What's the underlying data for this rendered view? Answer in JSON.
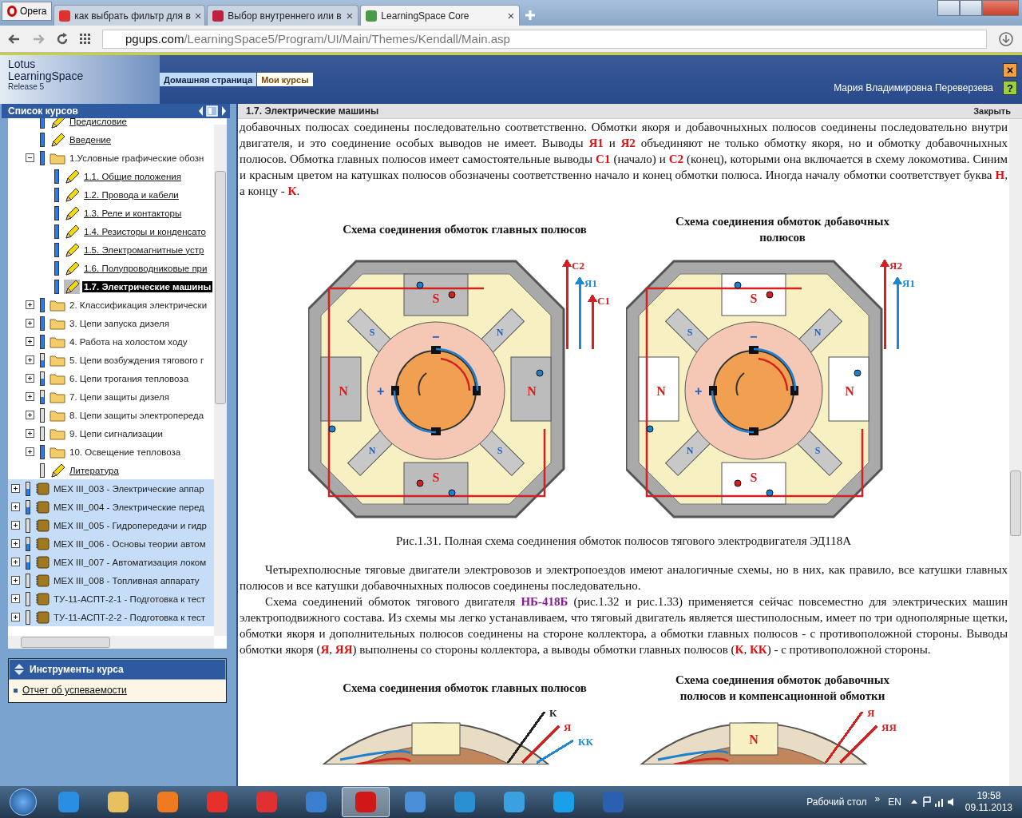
{
  "browser": {
    "menu": "Opera",
    "tabs": [
      {
        "title": "как выбрать фильтр для в",
        "kind": "yandex",
        "close": "×",
        "selected": false
      },
      {
        "title": "Выбор внутреннего или в",
        "kind": "bug",
        "close": "×",
        "selected": false
      },
      {
        "title": "LearningSpace Core",
        "kind": "ls",
        "close": "×",
        "selected": true
      }
    ],
    "address": {
      "domain": "pgups.com",
      "path": "/LearningSpace5/Program/UI/Main/Themes/Kendall/Main.asp"
    }
  },
  "header": {
    "logo": [
      "Lotus",
      "LearningSpace",
      "Release 5"
    ],
    "tabs": [
      {
        "label": "Домашняя страница",
        "selected": false
      },
      {
        "label": "Мои курсы",
        "selected": true
      }
    ],
    "user": "Мария Владимировна Переверзева",
    "close": "×",
    "help": "?"
  },
  "sidebar": {
    "title": "Список курсов",
    "items": [
      {
        "label": "Предисловие",
        "kind": "lesson",
        "level": 1,
        "selected": false
      },
      {
        "label": "Введение",
        "kind": "lesson",
        "level": 1,
        "selected": false
      },
      {
        "label": "1.Условные графические обозн",
        "kind": "folder",
        "level": 1,
        "expanded": true,
        "selected": false,
        "children": [
          {
            "label": "1.1. Общие положения",
            "kind": "lesson",
            "level": 1,
            "selected": false
          },
          {
            "label": "1.2. Провода и кабели",
            "kind": "lesson",
            "level": 1,
            "selected": false
          },
          {
            "label": "1.3. Реле и контакторы",
            "kind": "lesson",
            "level": 1,
            "selected": false
          },
          {
            "label": "1.4. Резисторы и конденсато",
            "kind": "lesson",
            "level": 1,
            "selected": false
          },
          {
            "label": "1.5. Электромагнитные устр",
            "kind": "lesson",
            "level": 1,
            "selected": false
          },
          {
            "label": "1.6. Полупроводниковые при",
            "kind": "lesson",
            "level": 1,
            "selected": false
          },
          {
            "label": "1.7. Электрические машины",
            "kind": "lesson",
            "level": 1,
            "selected": true
          }
        ]
      },
      {
        "label": "2. Классификация электрически",
        "kind": "folder",
        "level": 1,
        "expanded": false,
        "selected": false
      },
      {
        "label": "3. Цепи запуска дизеля",
        "kind": "folder",
        "level": 1,
        "expanded": false,
        "selected": false
      },
      {
        "label": "4. Работа на холостом ходу",
        "kind": "folder",
        "level": 1,
        "expanded": false,
        "selected": false
      },
      {
        "label": "5. Цепи возбуждения тягового г",
        "kind": "folder",
        "level": 0.5,
        "expanded": false,
        "selected": false
      },
      {
        "label": "6. Цепи трогания тепловоза",
        "kind": "folder",
        "level": 0.5,
        "expanded": false,
        "selected": false
      },
      {
        "label": "7. Цепи защиты дизеля",
        "kind": "folder",
        "level": 0.5,
        "expanded": false,
        "selected": false
      },
      {
        "label": "8. Цепи защиты электропереда",
        "kind": "folder",
        "level": 0,
        "expanded": false,
        "selected": false
      },
      {
        "label": "9. Цепи сигнализации",
        "kind": "folder",
        "level": 0,
        "expanded": false,
        "selected": false
      },
      {
        "label": "10. Освещение тепловоза",
        "kind": "folder",
        "level": 1,
        "expanded": false,
        "selected": false
      },
      {
        "label": "Литература",
        "kind": "lesson",
        "level": 0,
        "selected": false
      }
    ],
    "courses": [
      {
        "label": "MEX III_003 - Электрические аппар",
        "level": 0.5,
        "expanded": false
      },
      {
        "label": "MEX III_004 - Электрические перед",
        "level": 0.5,
        "expanded": false
      },
      {
        "label": "MEX III_005 - Гидропередачи и гидр",
        "level": 0,
        "expanded": false
      },
      {
        "label": "MEX III_006 - Основы теории автом",
        "level": 0.5,
        "expanded": false
      },
      {
        "label": "MEX III_007 - Автоматизация локом",
        "level": 0.5,
        "expanded": false
      },
      {
        "label": "MEX III_008 - Топливная аппарату",
        "level": 0,
        "expanded": false
      },
      {
        "label": "ТУ-11-АСПТ-2-1 - Подготовка к тест",
        "level": 0,
        "expanded": false
      },
      {
        "label": "ТУ-11-АСПТ-2-2 - Подготовка к тест",
        "level": 0,
        "expanded": false
      }
    ],
    "tools": {
      "title": "Инструменты курса",
      "links": [
        "Отчет об успеваемости"
      ]
    }
  },
  "content": {
    "title": "1.7. Электрические машины",
    "close": "Закрыть",
    "blocks": [
      {
        "kind": "paragraph",
        "continued": true,
        "segments": [
          {
            "kind": "text",
            "text": "добавочных полюсах соединены последовательно соответственно. Обмотки якоря и добавочныхных полюсов соединены последовательно внутри двигателя, и это соединение особых выводов не имеет. Выводы "
          },
          {
            "kind": "red",
            "text": "Я1"
          },
          {
            "kind": "text",
            "text": " и "
          },
          {
            "kind": "red",
            "text": "Я2"
          },
          {
            "kind": "text",
            "text": " объединяют не только обмотку якоря, но и обмотку добавочныхных полюсов. Обмотка главных полюсов имеет самостоятельные выводы "
          },
          {
            "kind": "red",
            "text": "С1"
          },
          {
            "kind": "text",
            "text": " (начало) и "
          },
          {
            "kind": "red",
            "text": "С2"
          },
          {
            "kind": "text",
            "text": " (конец), которыми она включается в схему локомотива. Синим и красным цветом на катушках полюсов обозначены соответственно начало и конец обмотки полюса. Иногда началу обмотки соответствует буква "
          },
          {
            "kind": "red",
            "text": "Н"
          },
          {
            "kind": "text",
            "text": ", а концу - "
          },
          {
            "kind": "red",
            "text": "К"
          },
          {
            "kind": "text",
            "text": "."
          }
        ]
      },
      {
        "kind": "figure",
        "partial": false,
        "caption": "Рис.1.31. Полная схема соединения обмоток полюсов тягового электродвигателя ЭД118А",
        "diagrams": [
          {
            "title": "Схема соединения обмоток главных полюсов",
            "leads": [
              {
                "label": "С2",
                "color": "#d42020"
              },
              {
                "label": "Я1",
                "color": "#1e88d8"
              },
              {
                "label": "С1",
                "color": "#d42020"
              }
            ],
            "poles": [
              "S",
              "S",
              "N",
              "N",
              "S",
              "N",
              "N",
              "S"
            ],
            "plus": "+",
            "minus": "−"
          },
          {
            "title": "Схема соединения обмоток добавочных полюсов",
            "leads": [
              {
                "label": "Я2",
                "color": "#d42020"
              },
              {
                "label": "Я1",
                "color": "#1e88d8"
              }
            ],
            "poles": [
              "S",
              "S",
              "N",
              "N",
              "S",
              "N",
              "N",
              "S"
            ],
            "plus": "+",
            "minus": "−"
          }
        ]
      },
      {
        "kind": "paragraph",
        "continued": false,
        "segments": [
          {
            "kind": "text",
            "text": "Четырехполюсные тяговые двигатели электровозов и электропоездов имеют аналогичные схемы, но в них, как правило, все катушки главных полюсов и все катушки добавочныхных полюсов соединены последовательно."
          }
        ]
      },
      {
        "kind": "paragraph",
        "continued": false,
        "segments": [
          {
            "kind": "text",
            "text": "Схема соединений обмоток тягового двигателя "
          },
          {
            "kind": "purple",
            "text": "НБ-418Б"
          },
          {
            "kind": "text",
            "text": " (рис.1.32 и рис.1.33) применяется сейчас повсеместно для электрических машин электроподвижного состава. Из схемы мы легко устанавливаем, что тяговый двигатель является шестиполосным, имеет по три однополярные щетки, обмотки якоря и дополнительных полюсов соединены на стороне коллектора, а обмотки главных полюсов - с противоположной стороны. Выводы обмотки якоря ("
          },
          {
            "kind": "red",
            "text": "Я"
          },
          {
            "kind": "text",
            "text": ", "
          },
          {
            "kind": "red",
            "text": "ЯЯ"
          },
          {
            "kind": "text",
            "text": ") выполнены со стороны коллектора, а выводы обмотки главных полюсов ("
          },
          {
            "kind": "red",
            "text": "К"
          },
          {
            "kind": "text",
            "text": ", "
          },
          {
            "kind": "red",
            "text": "КК"
          },
          {
            "kind": "text",
            "text": ") - с противоположной стороны."
          }
        ]
      },
      {
        "kind": "figure",
        "partial": true,
        "diagrams": [
          {
            "title": "Схема соединения обмоток главных полюсов",
            "leads": [
              {
                "label": "К",
                "color": "#222222"
              },
              {
                "label": "Я",
                "color": "#d42020"
              },
              {
                "label": "КК",
                "color": "#1e88d8"
              }
            ]
          },
          {
            "title": "Схема соединения обмоток добавочных полюсов и компенсационной обмотки",
            "leads": [
              {
                "label": "Я",
                "color": "#d42020"
              },
              {
                "label": "ЯЯ",
                "color": "#d42020"
              }
            ],
            "poles": [
              "N"
            ]
          }
        ]
      }
    ]
  },
  "taskbar": {
    "apps": [
      {
        "kind": "ie",
        "selected": false
      },
      {
        "kind": "folder",
        "selected": false
      },
      {
        "kind": "media",
        "selected": false
      },
      {
        "kind": "yabrowser",
        "selected": false
      },
      {
        "kind": "yandex",
        "selected": false
      },
      {
        "kind": "mail",
        "selected": false
      },
      {
        "kind": "opera",
        "selected": true
      },
      {
        "kind": "sound",
        "selected": false
      },
      {
        "kind": "at",
        "selected": false
      },
      {
        "kind": "bird",
        "selected": false
      },
      {
        "kind": "skype",
        "selected": false
      },
      {
        "kind": "word",
        "selected": false
      }
    ],
    "desktop": "Рабочий стол",
    "more": "»",
    "lang": "EN",
    "time": "19:58",
    "date": "09.11.2013"
  }
}
